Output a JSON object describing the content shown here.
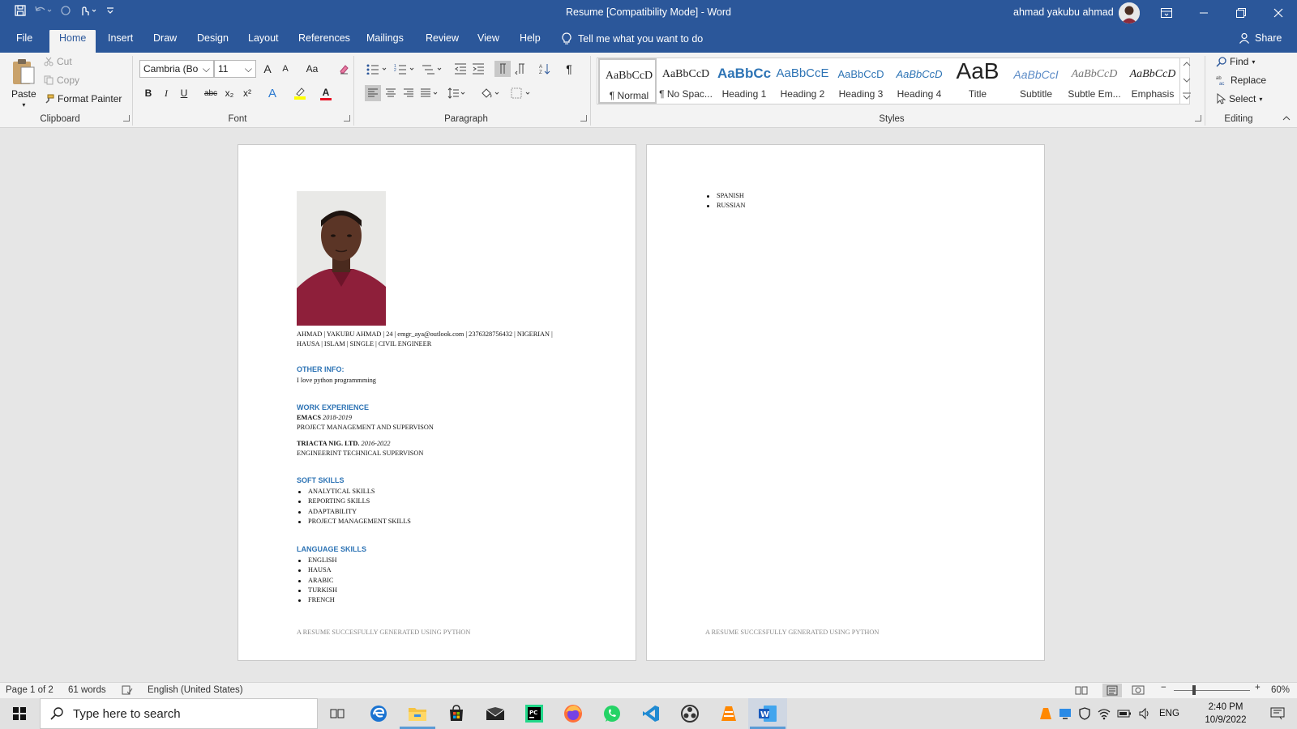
{
  "window": {
    "title": "Resume [Compatibility Mode]  -  Word",
    "user_name": "ahmad yakubu ahmad"
  },
  "tabs": [
    "File",
    "Home",
    "Insert",
    "Draw",
    "Design",
    "Layout",
    "References",
    "Mailings",
    "Review",
    "View",
    "Help"
  ],
  "active_tab": "Home",
  "tell_me": "Tell me what you want to do",
  "share": "Share",
  "clipboard": {
    "paste": "Paste",
    "cut": "Cut",
    "copy": "Copy",
    "format_painter": "Format Painter",
    "group_label": "Clipboard"
  },
  "font": {
    "name": "Cambria (Bo",
    "size": "11",
    "group_label": "Font",
    "bold": "B",
    "italic": "I",
    "underline": "U",
    "strike": "abc",
    "subscript": "x₂",
    "superscript": "x²",
    "change_case": "Aa",
    "grow": "A",
    "shrink": "A",
    "text_effects": "A",
    "font_color": "A"
  },
  "paragraph": {
    "group_label": "Paragraph",
    "pilcrow": "¶"
  },
  "styles": {
    "group_label": "Styles",
    "items": [
      {
        "preview": "AaBbCcD",
        "label": "¶ Normal"
      },
      {
        "preview": "AaBbCcD",
        "label": "¶ No Spac..."
      },
      {
        "preview": "AaBbCc",
        "label": "Heading 1"
      },
      {
        "preview": "AaBbCcE",
        "label": "Heading 2"
      },
      {
        "preview": "AaBbCcD",
        "label": "Heading 3"
      },
      {
        "preview": "AaBbCcD",
        "label": "Heading 4"
      },
      {
        "preview": "AaB",
        "label": "Title"
      },
      {
        "preview": "AaBbCcI",
        "label": "Subtitle"
      },
      {
        "preview": "AaBbCcD",
        "label": "Subtle Em..."
      },
      {
        "preview": "AaBbCcD",
        "label": "Emphasis"
      }
    ]
  },
  "editing": {
    "find": "Find",
    "replace": "Replace",
    "select": "Select",
    "group_label": "Editing"
  },
  "resume": {
    "contact_line1": "AHMAD  | YAKUBU AHMAD | 24 | emgr_aya@outlook.com | 2376328756432 | NIGERIAN |",
    "contact_line2": "HAUSA | ISLAM | SINGLE | CIVIL ENGINEER",
    "other_info_heading": "OTHER INFO:",
    "other_info_text": "I love python programmming",
    "work_heading": "WORK EXPERIENCE",
    "jobs": [
      {
        "company": "EMACS",
        "years": "2018-2019",
        "role": "PROJECT MANAGEMENT AND SUPERVISON"
      },
      {
        "company": "TRIACTA NIG. LTD.",
        "years": "2016-2022",
        "role": "ENGINEERINT TECHNICAL SUPERVISON"
      }
    ],
    "soft_heading": "SOFT SKILLS",
    "soft_skills": [
      "ANALYTICAL SKILLS",
      "REPORTING SKILLS",
      "ADAPTABILITY",
      "PROJECT MANAGEMENT SKILLS"
    ],
    "lang_heading": "LANGUAGE SKILLS",
    "languages_page1": [
      "ENGLISH",
      "HAUSA",
      "ARABIC",
      "TURKISH",
      "FRENCH"
    ],
    "languages_page2": [
      "SPANISH",
      "RUSSIAN"
    ],
    "footer": "A RESUME SUCCESFULLY GENERATED USING PYTHON"
  },
  "status": {
    "page": "Page 1 of 2",
    "words": "61 words",
    "language": "English (United States)",
    "zoom": "60%"
  },
  "taskbar": {
    "search_placeholder": "Type here to search",
    "language": "ENG",
    "time": "2:40 PM",
    "date": "10/9/2022"
  }
}
